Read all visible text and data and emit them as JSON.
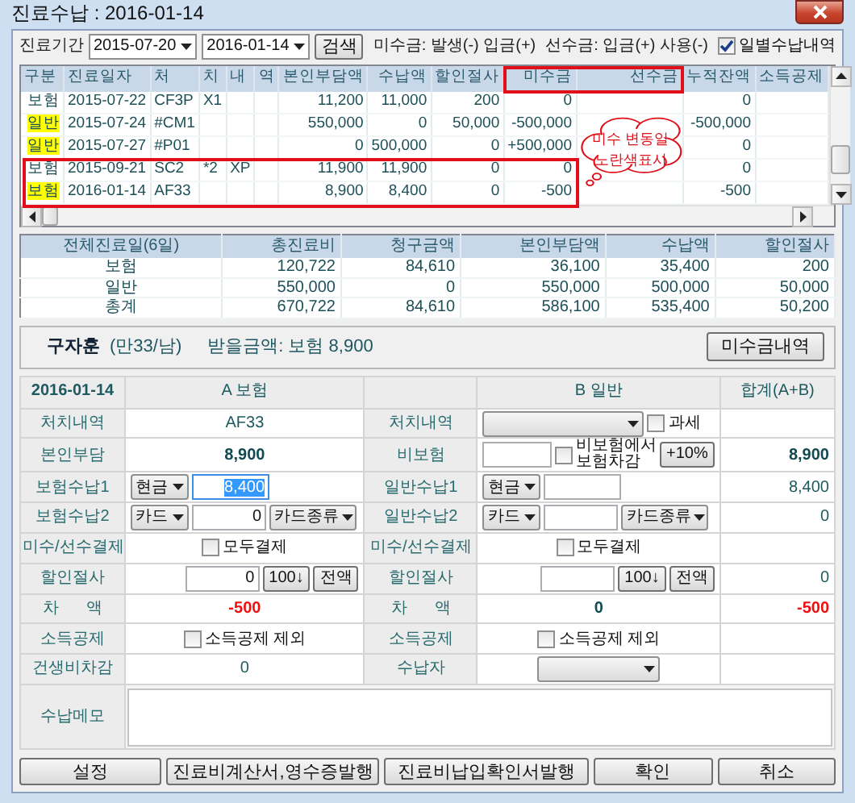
{
  "window": {
    "title": "진료수납 : 2016-01-14"
  },
  "filter": {
    "label": "진료기간",
    "from": "2015-07-20",
    "to": "2016-01-14",
    "search_button": "검색",
    "legend_unpaid": "미수금: 발생(-) 입금(+)",
    "legend_prepaid": "선수금: 입금(+) 사용(-)",
    "daily_checkbox": {
      "label": "일별수납내역",
      "checked": true
    }
  },
  "history": {
    "columns": [
      {
        "label": "구분",
        "framed": false
      },
      {
        "label": "진료일자",
        "framed": false
      },
      {
        "label": "처",
        "framed": false
      },
      {
        "label": "치",
        "framed": false
      },
      {
        "label": "내",
        "framed": false
      },
      {
        "label": "역",
        "framed": false
      },
      {
        "label": "본인부담액",
        "framed": false
      },
      {
        "label": "수납액",
        "framed": false
      },
      {
        "label": "할인절사",
        "framed": false
      },
      {
        "label": "미수금",
        "framed": true
      },
      {
        "label": "선수금",
        "framed": true
      },
      {
        "label": "누적잔액",
        "framed": false
      },
      {
        "label": "소득공제",
        "framed": false
      }
    ],
    "rows": [
      {
        "category": "보험",
        "highlighted": false,
        "framed": false,
        "date": "2015-07-22",
        "treatment_1": "CF3P",
        "treatment_2": "X1",
        "patient_charge": "11,200",
        "paid": "11,000",
        "discount": "200",
        "unpaid": "0",
        "balance": "0"
      },
      {
        "category": "일반",
        "highlighted": true,
        "framed": false,
        "date": "2015-07-24",
        "treatment_1": "#CM1",
        "patient_charge": "550,000",
        "paid": "0",
        "discount": "50,000",
        "unpaid": "-500,000",
        "balance": "-500,000"
      },
      {
        "category": "일반",
        "highlighted": true,
        "framed": false,
        "date": "2015-07-27",
        "treatment_1": "#P01",
        "patient_charge": "0",
        "paid": "500,000",
        "discount": "0",
        "unpaid": "+500,000",
        "balance": "0"
      },
      {
        "category": "보험",
        "highlighted": false,
        "framed": true,
        "date": "2015-09-21",
        "treatment_1": "SC2",
        "treatment_2": "*2",
        "treatment_3": "XP",
        "patient_charge": "11,900",
        "paid": "11,900",
        "discount": "0",
        "unpaid": "0",
        "balance": "0"
      },
      {
        "category": "보험",
        "highlighted": true,
        "framed": true,
        "date": "2016-01-14",
        "treatment_1": "AF33",
        "patient_charge": "8,900",
        "paid": "8,400",
        "discount": "0",
        "unpaid": "-500",
        "balance": "-500"
      }
    ],
    "callout": [
      "미수 변동일",
      "노란색표시"
    ]
  },
  "summary": {
    "columns": [
      "전체진료일(6일)",
      "총진료비",
      "청구금액",
      "본인부담액",
      "수납액",
      "할인절사"
    ],
    "rows": [
      [
        "보험",
        "120,722",
        "84,610",
        "36,100",
        "35,400",
        "200"
      ],
      [
        "일반",
        "550,000",
        "0",
        "550,000",
        "500,000",
        "50,000"
      ],
      [
        "총계",
        "670,722",
        "84,610",
        "586,100",
        "535,400",
        "50,200"
      ]
    ]
  },
  "patient": {
    "name": "구자훈",
    "info": "(만33/남)",
    "amount": "받을금액: 보험 8,900",
    "button": "미수금내역"
  },
  "form": {
    "header": {
      "date": "2016-01-14",
      "a": "A 보험",
      "b": "B 일반",
      "total": "합계(A+B)"
    },
    "rows": [
      {
        "label_a": "처치내역",
        "a": [
          {
            "kind": "text",
            "value": "AF33",
            "emphasized": false,
            "negative": false
          }
        ],
        "label_b": "처치내역",
        "b": [
          {
            "kind": "select"
          },
          {
            "kind": "checkbox",
            "label": "과세",
            "checked": false
          }
        ]
      },
      {
        "label_a": "본인부담",
        "a": [
          {
            "kind": "text",
            "value": "8,900",
            "emphasized": true,
            "negative": false
          }
        ],
        "label_b": "비보험",
        "b": [
          {
            "kind": "input",
            "selected": false
          },
          {
            "kind": "checkbox",
            "label": "비보험에서 보험차감",
            "checked": false
          },
          {
            "kind": "button",
            "label": "+10%"
          }
        ],
        "total": {
          "value": "8,900",
          "emphasized": true,
          "negative": false
        }
      },
      {
        "label_a": "보험수납1",
        "a": [
          {
            "kind": "select",
            "value": "현금"
          },
          {
            "kind": "input",
            "value": "8,400",
            "selected": true
          }
        ],
        "label_b": "일반수납1",
        "b": [
          {
            "kind": "select",
            "value": "현금"
          },
          {
            "kind": "input",
            "selected": false
          }
        ],
        "total": {
          "value": "8,400",
          "emphasized": false,
          "negative": false
        }
      },
      {
        "label_a": "보험수납2",
        "a": [
          {
            "kind": "select",
            "value": "카드"
          },
          {
            "kind": "input",
            "value": "0",
            "selected": false
          },
          {
            "kind": "select",
            "value": "카드종류"
          }
        ],
        "label_b": "일반수납2",
        "b": [
          {
            "kind": "select",
            "value": "카드"
          },
          {
            "kind": "input",
            "selected": false
          },
          {
            "kind": "select",
            "value": "카드종류"
          }
        ],
        "total": {
          "value": "0",
          "emphasized": false,
          "negative": false
        }
      },
      {
        "label_a": "미수/선수결제",
        "a": [
          {
            "kind": "checkbox",
            "label": "모두결제",
            "checked": false
          }
        ],
        "label_b": "미수/선수결제",
        "b": [
          {
            "kind": "checkbox",
            "label": "모두결제",
            "checked": false
          }
        ]
      },
      {
        "label_a": "할인절사",
        "a": [
          {
            "kind": "input",
            "value": "0",
            "selected": false
          },
          {
            "kind": "button",
            "label": "100↓"
          },
          {
            "kind": "button",
            "label": "전액"
          }
        ],
        "label_b": "할인절사",
        "b": [
          {
            "kind": "input",
            "selected": false
          },
          {
            "kind": "button",
            "label": "100↓"
          },
          {
            "kind": "button",
            "label": "전액"
          }
        ],
        "total": {
          "value": "0",
          "emphasized": false,
          "negative": false
        }
      },
      {
        "label_a": "차 액",
        "a": [
          {
            "kind": "text",
            "value": "-500",
            "emphasized": true,
            "negative": true
          }
        ],
        "label_b": "차 액",
        "b": [
          {
            "kind": "text",
            "value": "0",
            "emphasized": true,
            "negative": false
          }
        ],
        "total": {
          "value": "-500",
          "emphasized": true,
          "negative": true
        }
      },
      {
        "label_a": "소득공제",
        "a": [
          {
            "kind": "checkbox",
            "label": "소득공제 제외",
            "checked": false
          }
        ],
        "label_b": "소득공제",
        "b": [
          {
            "kind": "checkbox",
            "label": "소득공제 제외",
            "checked": false
          }
        ]
      },
      {
        "label_a": "건생비차감",
        "a": [
          {
            "kind": "text",
            "value": "0",
            "emphasized": false,
            "negative": false
          }
        ],
        "label_b": "수납자",
        "b": [
          {
            "kind": "select"
          }
        ]
      }
    ],
    "memo_label": "수납메모"
  },
  "buttons": [
    "설정",
    "진료비계산서,영수증발행",
    "진료비납입확인서발행",
    "확인",
    "취소"
  ]
}
